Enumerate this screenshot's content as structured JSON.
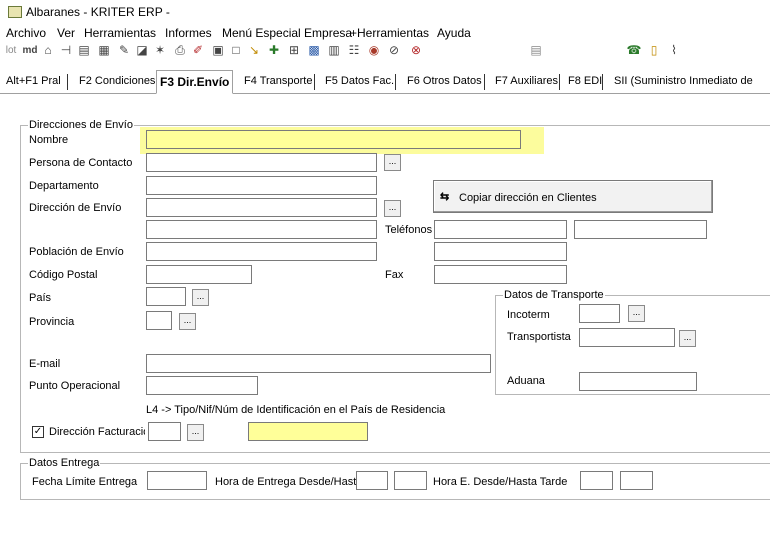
{
  "window": {
    "title": "Albaranes - KRITER ERP -"
  },
  "menu": [
    "Archivo",
    "Ver",
    "Herramientas",
    "Informes",
    "Menú Especial Empresa",
    "+Herramientas",
    "Ayuda"
  ],
  "toolbar": {
    "icons": [
      "lot-icon",
      "md-icon",
      "tools-icon",
      "split-icon",
      "sheet-icon",
      "grid-icon",
      "wand-icon",
      "preview-icon",
      "star-icon",
      "print-icon",
      "pen-icon",
      "form-icon",
      "window-icon",
      "clip-icon",
      "add-icon",
      "tree-icon",
      "table-icon",
      "layout-icon",
      "yellowgrid-icon",
      "globe-icon",
      "check-icon",
      "calc-icon",
      "people-icon",
      "battery-icon",
      "attach-icon"
    ],
    "lot_label": "lot",
    "md_label": "md"
  },
  "tabs": [
    {
      "label": "Alt+F1 Pral",
      "active": false
    },
    {
      "label": "F2 Condiciones",
      "active": false
    },
    {
      "label": "F3 Dir.Envío",
      "active": true
    },
    {
      "label": "F4 Transporte",
      "active": false
    },
    {
      "label": "F5 Datos Fac.",
      "active": false
    },
    {
      "label": "F6 Otros Datos",
      "active": false
    },
    {
      "label": "F7 Auxiliares",
      "active": false
    },
    {
      "label": "F8 EDI",
      "active": false
    },
    {
      "label": "SII (Suministro Inmediato de",
      "active": false
    }
  ],
  "shipping": {
    "legend": "Direcciones de Envío",
    "nombre_label": "Nombre",
    "nombre_value": "",
    "contacto_label": "Persona de Contacto",
    "departamento_label": "Departamento",
    "direccion_label": "Dirección de Envío",
    "poblacion_label": "Población de Envío",
    "cp_label": "Código Postal",
    "pais_label": "País",
    "provincia_label": "Provincia",
    "telefonos_label": "Teléfonos",
    "fax_label": "Fax",
    "copy_button": "Copiar dirección en Clientes",
    "email_label": "E-mail",
    "punto_label": "Punto Operacional",
    "l4_note": "L4 -> Tipo/Nif/Núm de Identificación en el País de Residencia",
    "dir_fact_label": "Dirección Facturación",
    "dir_fact_checked": true,
    "ellipsis": "..."
  },
  "transport": {
    "legend": "Datos de Transporte",
    "incoterm_label": "Incoterm",
    "transportista_label": "Transportista",
    "aduana_label": "Aduana"
  },
  "delivery": {
    "legend": "Datos Entrega",
    "fecha_label": "Fecha Límite Entrega",
    "hora_label": "Hora de Entrega Desde/Hasta",
    "hora_tarde_label": "Hora E. Desde/Hasta Tarde"
  }
}
